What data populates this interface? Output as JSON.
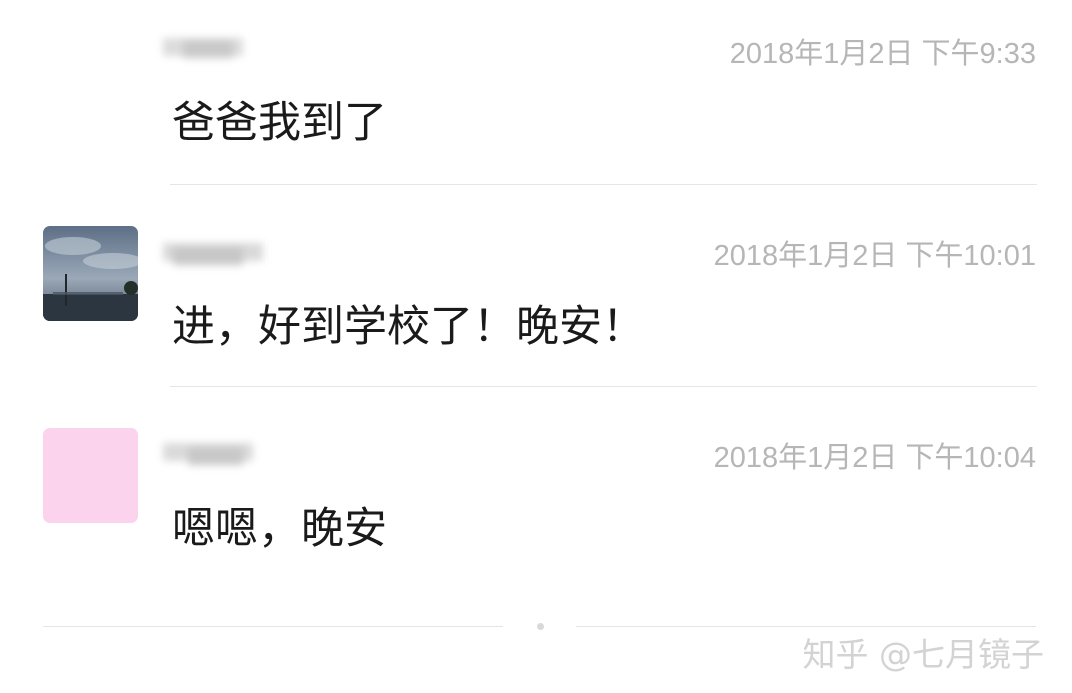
{
  "messages": [
    {
      "time": "2018年1月2日 下午9:33",
      "text": "爸爸我到了",
      "avatar": "none"
    },
    {
      "time": "2018年1月2日 下午10:01",
      "text": "进，好到学校了！晚安！",
      "avatar": "landscape-photo"
    },
    {
      "time": "2018年1月2日 下午10:04",
      "text": "嗯嗯，晚安",
      "avatar": "pink-square"
    }
  ],
  "watermark": "知乎 @七月镜子",
  "colors": {
    "timestamp": "#b6b6b6",
    "message_text": "#1a1a1a",
    "divider": "#e6e6e6",
    "pink_avatar": "#fbd3ed",
    "watermark": "#d3d3d3"
  }
}
